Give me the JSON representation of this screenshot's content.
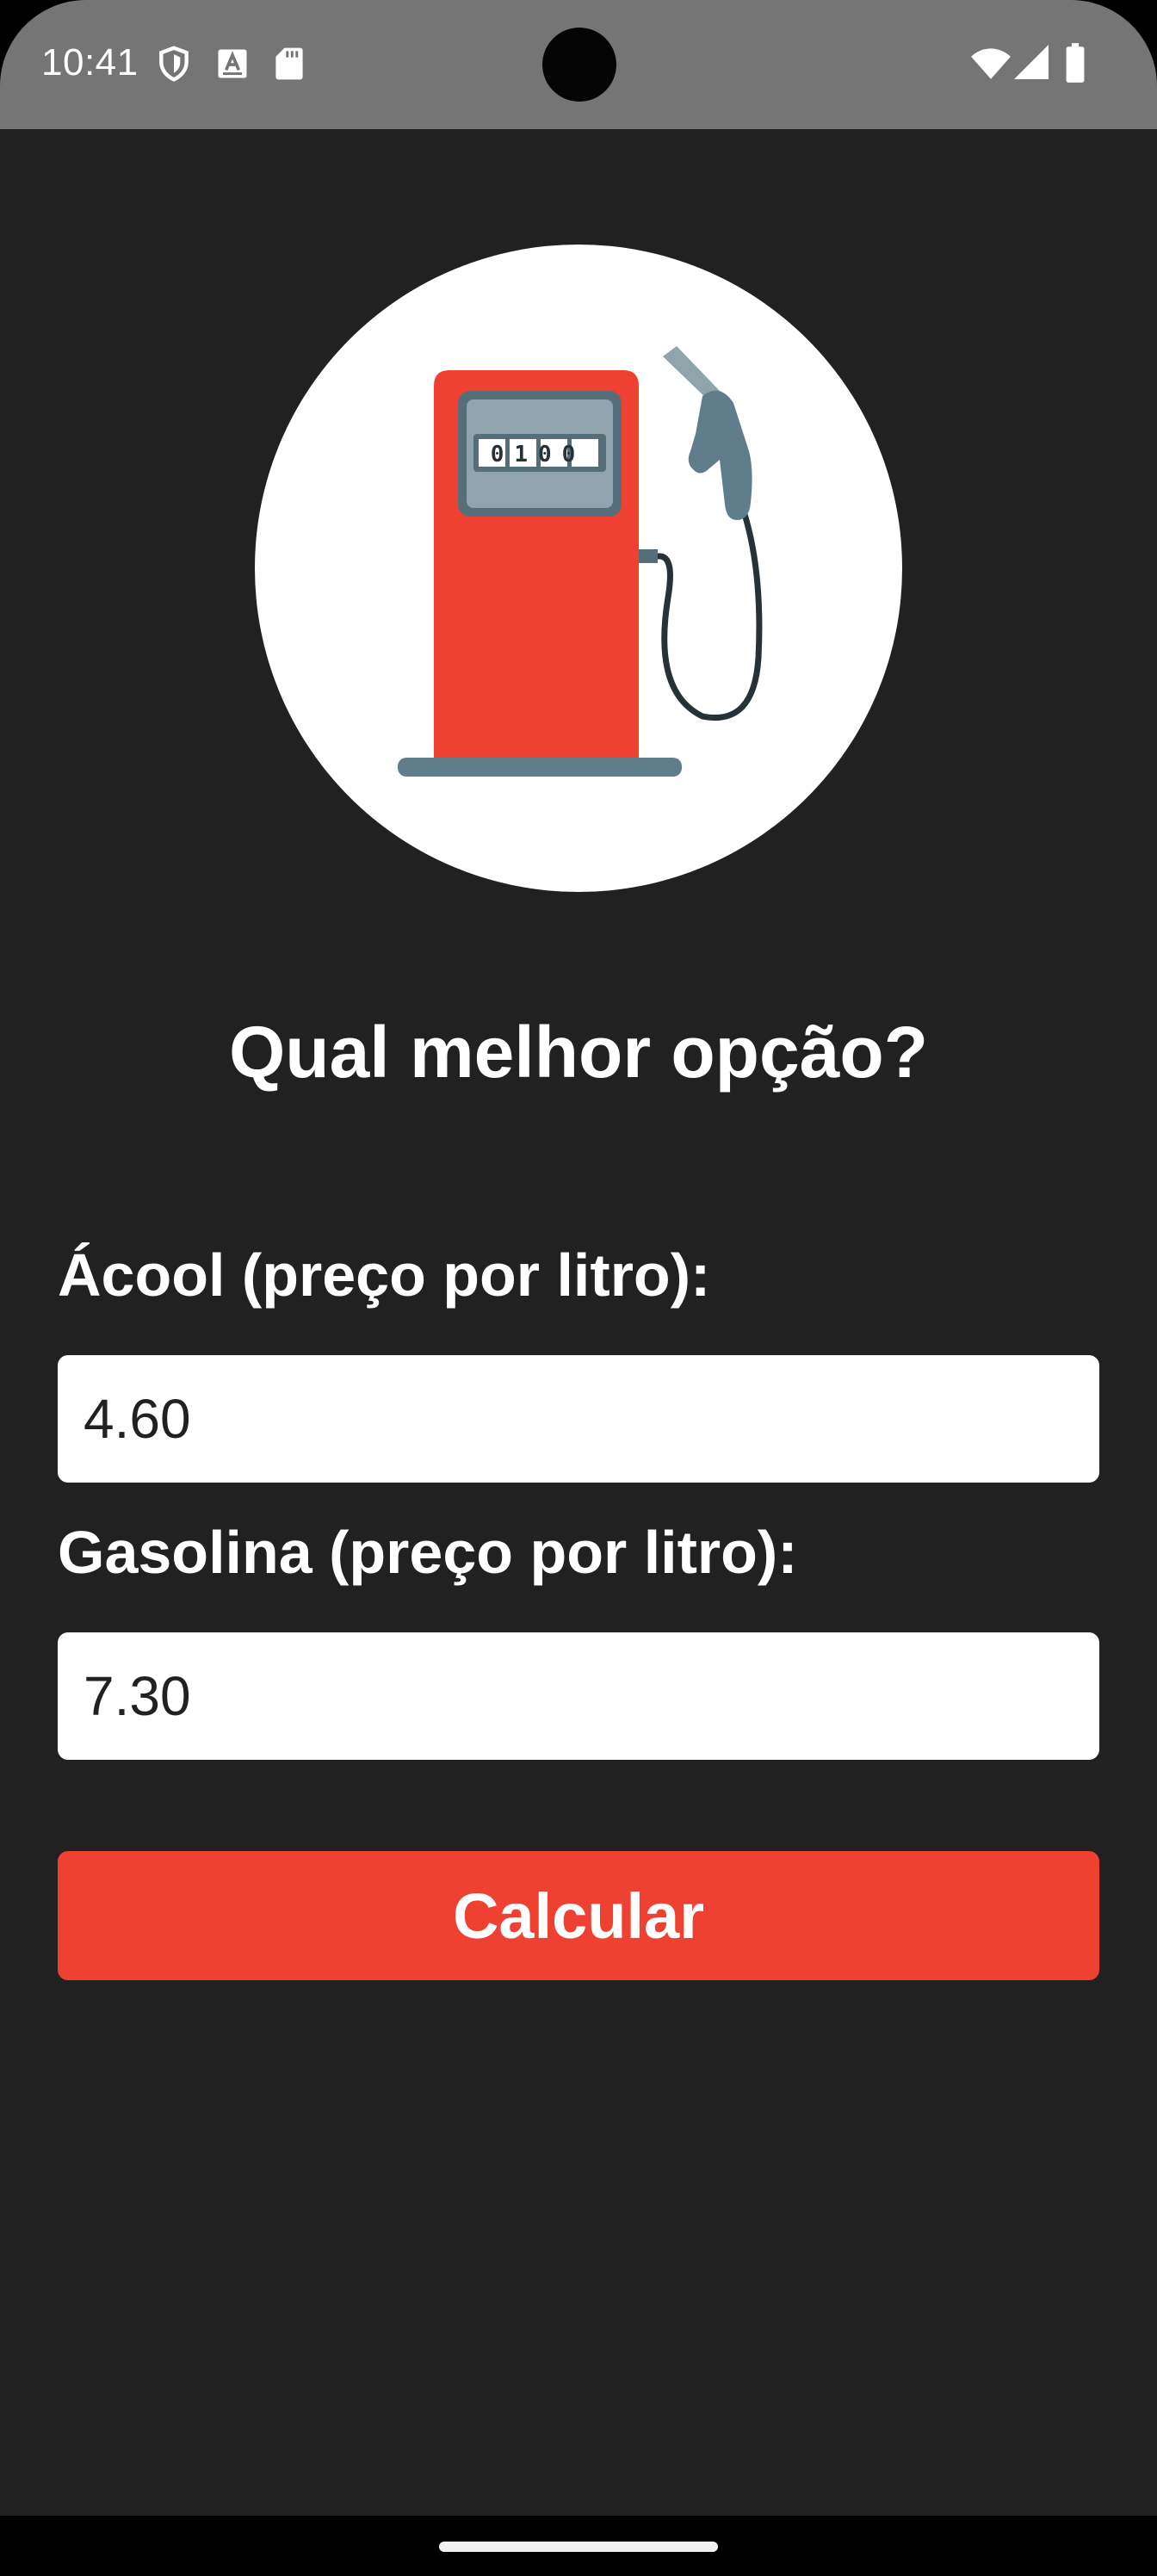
{
  "status_bar": {
    "time": "10:41",
    "icons_left": [
      "shield-icon",
      "keyboard-a-icon",
      "sd-card-icon"
    ],
    "icons_right": [
      "wifi-icon",
      "signal-icon",
      "battery-icon"
    ]
  },
  "app": {
    "image": "fuel-pump-image",
    "pump_display": "0100",
    "title": "Qual melhor opção?",
    "alcohol": {
      "label": "Ácool (preço por litro):",
      "value": "4.60"
    },
    "gasoline": {
      "label": "Gasolina (preço por litro):",
      "value": "7.30"
    },
    "calculate_label": "Calcular"
  },
  "colors": {
    "background": "#212121",
    "status_bar": "#757575",
    "accent": "#ee4132",
    "pump_body": "#ee4132",
    "pump_metal": "#607d8b"
  }
}
